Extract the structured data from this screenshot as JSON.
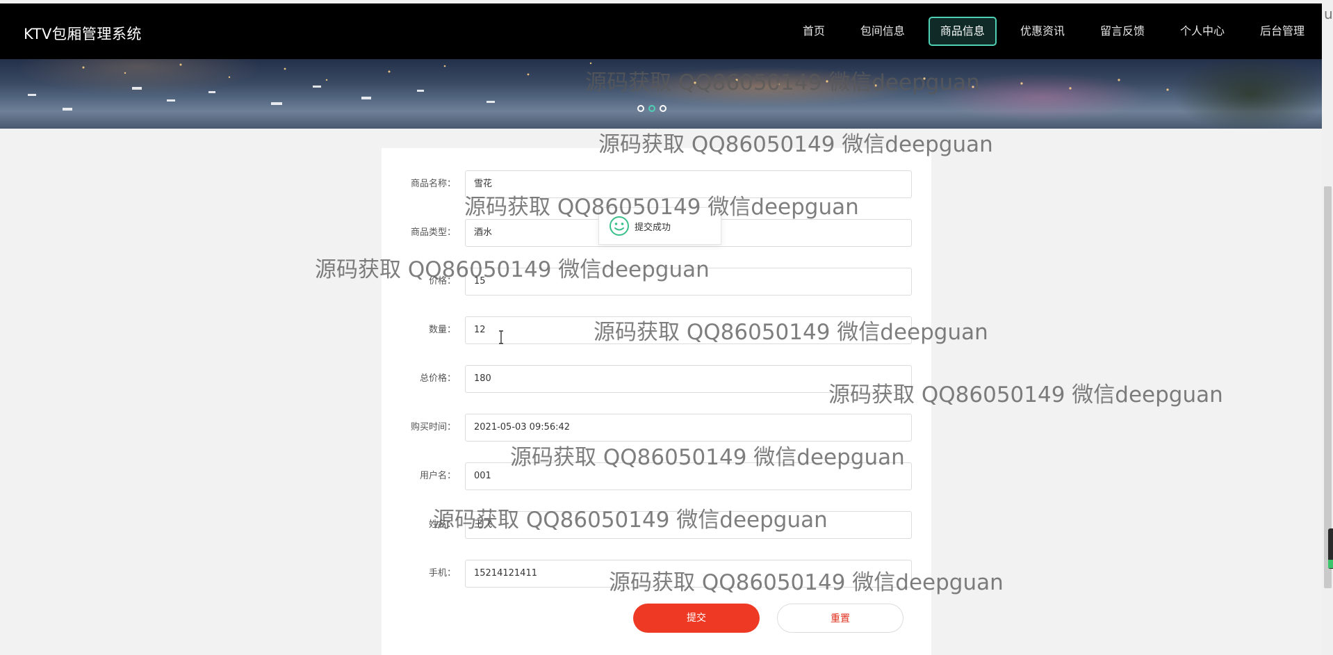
{
  "app": {
    "brand": "KTV包厢管理系统"
  },
  "nav": {
    "items": [
      {
        "label": "首页",
        "active": false
      },
      {
        "label": "包间信息",
        "active": false
      },
      {
        "label": "商品信息",
        "active": true
      },
      {
        "label": "优惠资讯",
        "active": false
      },
      {
        "label": "留言反馈",
        "active": false
      },
      {
        "label": "个人中心",
        "active": false
      },
      {
        "label": "后台管理",
        "active": false
      }
    ]
  },
  "banner": {
    "slide_count": 3,
    "active_slide": 2
  },
  "form": {
    "fields": [
      {
        "label": "商品名称：",
        "value": "雪花"
      },
      {
        "label": "商品类型：",
        "value": "酒水"
      },
      {
        "label": "价格：",
        "value": "15"
      },
      {
        "label": "数量：",
        "value": "12"
      },
      {
        "label": "总价格：",
        "value": "180"
      },
      {
        "label": "购买时间：",
        "value": "2021-05-03 09:56:42"
      },
      {
        "label": "用户名：",
        "value": "001"
      },
      {
        "label": "姓名：",
        "value": "王飞"
      },
      {
        "label": "手机：",
        "value": "15214121411"
      }
    ],
    "submit_label": "提交",
    "reset_label": "重置"
  },
  "toast": {
    "text": "提交成功",
    "icon": "smile-icon"
  },
  "watermark": {
    "text": "源码获取 QQ86050149 微信deepguan"
  },
  "colors": {
    "nav_bg": "#000000",
    "accent": "#4fd1b6",
    "submit": "#ee3a24",
    "page_bg": "#f2f2f2"
  },
  "misc": {
    "corner_glyph": "u"
  }
}
